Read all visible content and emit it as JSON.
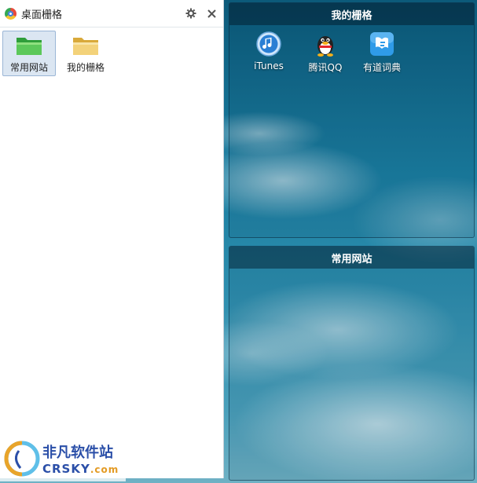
{
  "panel": {
    "title": "桌面栅格",
    "settings_icon": "gear-icon",
    "close_icon": "close-icon",
    "folders": [
      {
        "label": "常用网站",
        "icon": "green-folder-icon",
        "selected": true
      },
      {
        "label": "我的栅格",
        "icon": "yellow-folder-icon",
        "selected": false
      }
    ]
  },
  "desktop": {
    "grids": [
      {
        "title": "我的栅格",
        "apps": [
          {
            "label": "iTunes",
            "icon": "itunes-icon"
          },
          {
            "label": "腾讯QQ",
            "icon": "qq-penguin-icon"
          },
          {
            "label": "有道词典",
            "icon": "youdao-dict-icon"
          }
        ]
      },
      {
        "title": "常用网站",
        "apps": []
      }
    ]
  },
  "watermark": {
    "cn": "非凡软件站",
    "en": "CRSKY",
    "domain": ".com"
  },
  "colors": {
    "accent": "#2b4fa8",
    "selected_bg": "#dbe6f2"
  }
}
